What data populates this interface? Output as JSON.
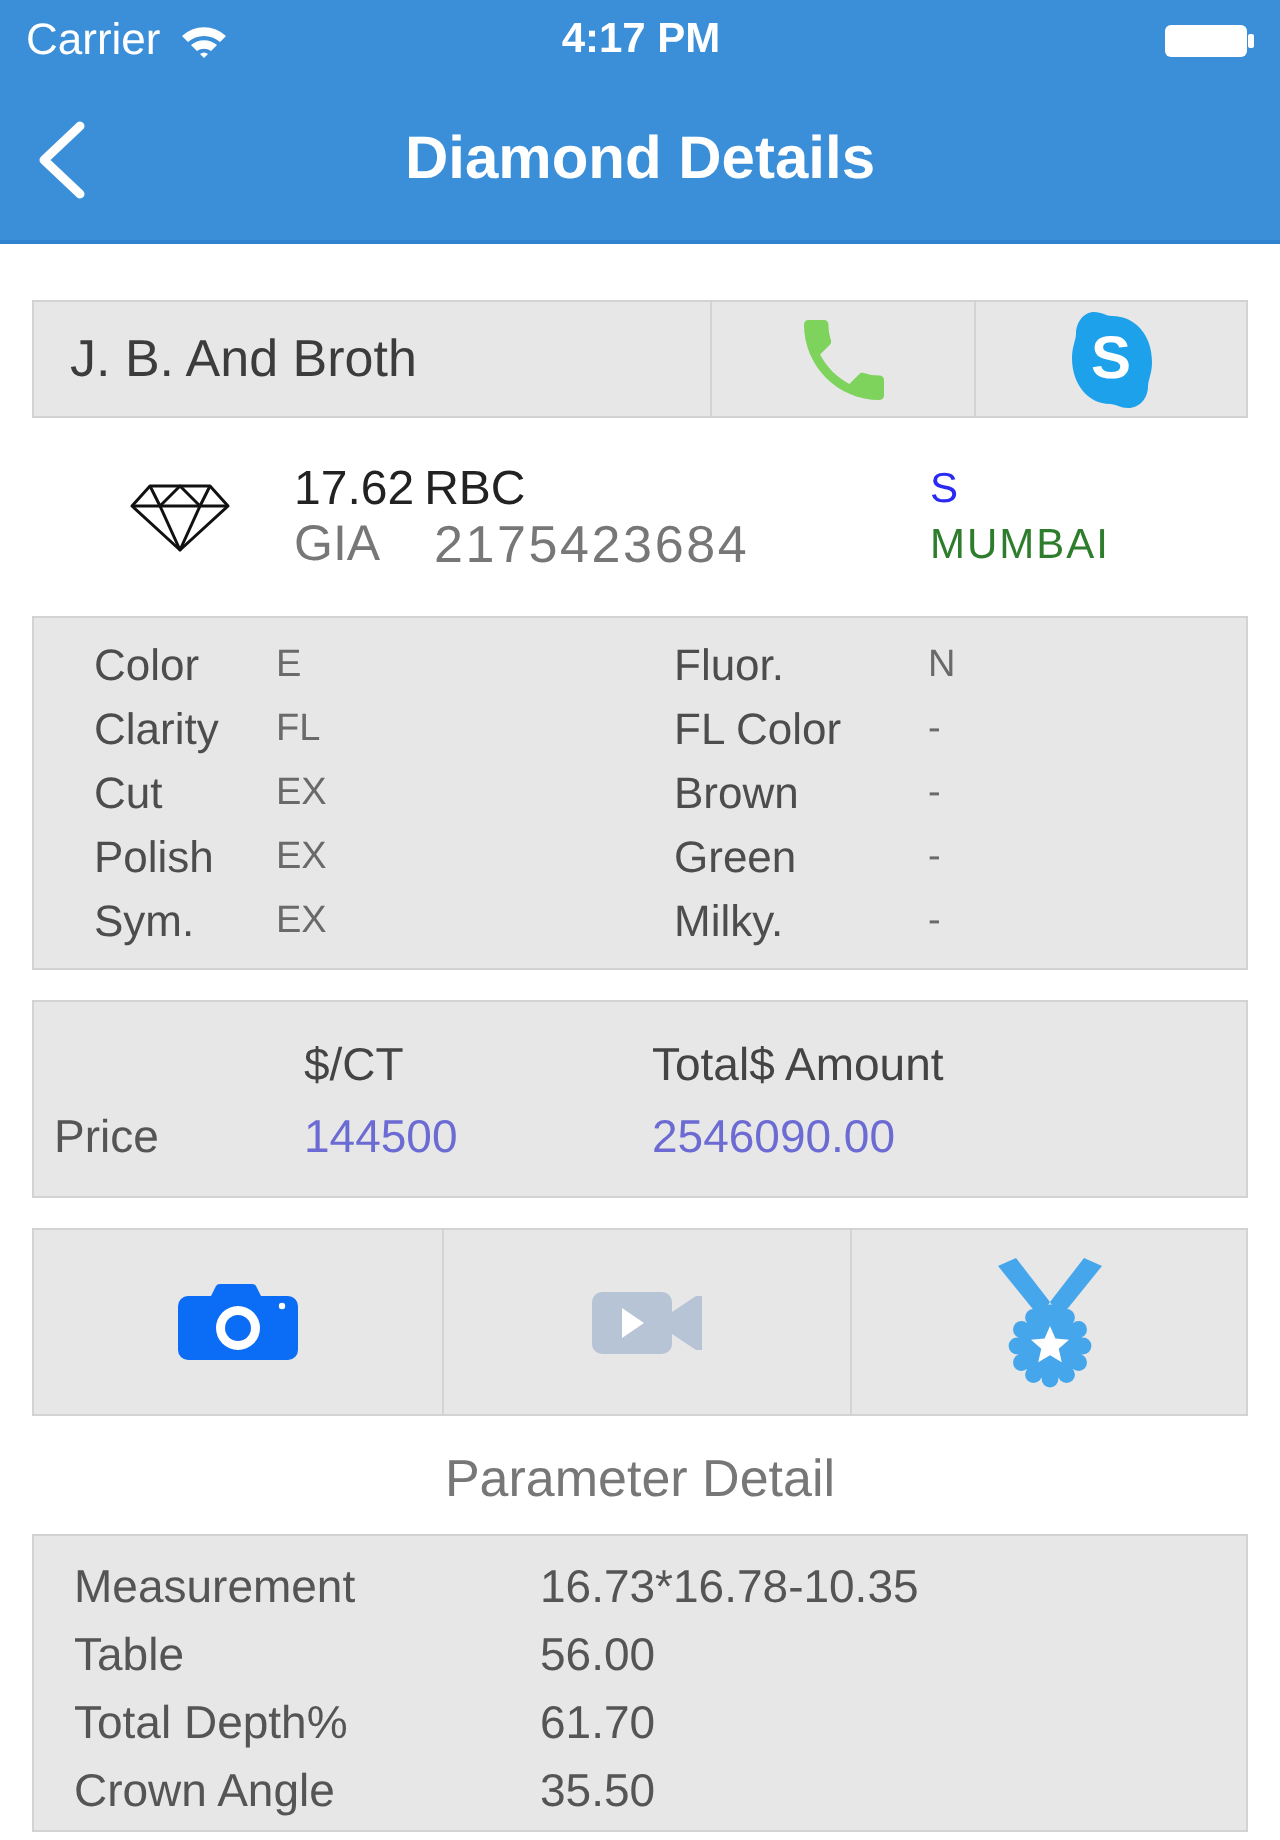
{
  "status_bar": {
    "carrier": "Carrier",
    "time": "4:17 PM"
  },
  "nav_bar": {
    "title": "Diamond Details"
  },
  "seller": {
    "name": "J. B. And Broth",
    "skype_logo_text": "S"
  },
  "stone": {
    "weight": "17.62",
    "shape": "RBC",
    "lab": "GIA",
    "report_number": "2175423684",
    "status": "S",
    "location": "MUMBAI"
  },
  "attributes": {
    "column_1": [
      {
        "label": "Color",
        "value": "E"
      },
      {
        "label": "Clarity",
        "value": "FL"
      },
      {
        "label": "Cut",
        "value": "EX"
      },
      {
        "label": "Polish",
        "value": "EX"
      },
      {
        "label": "Sym.",
        "value": "EX"
      }
    ],
    "column_2": [
      {
        "label": "Fluor.",
        "value": "N"
      },
      {
        "label": "FL Color",
        "value": "-"
      },
      {
        "label": "Brown",
        "value": "-"
      },
      {
        "label": "Green",
        "value": "-"
      },
      {
        "label": "Milky.",
        "value": "-"
      }
    ]
  },
  "price": {
    "row_label": "Price",
    "columns": [
      {
        "heading": "$/CT",
        "value": "144500"
      },
      {
        "heading": "Total$ Amount",
        "value": "2546090.00"
      }
    ]
  },
  "media_buttons": [
    {
      "kind": "camera",
      "disabled": false
    },
    {
      "kind": "video",
      "disabled": true
    },
    {
      "kind": "certificate",
      "disabled": false
    }
  ],
  "parameter_detail": {
    "title": "Parameter Detail",
    "rows": [
      {
        "label": "Measurement",
        "value": "16.73*16.78-10.35"
      },
      {
        "label": "Table",
        "value": "56.00"
      },
      {
        "label": "Total Depth%",
        "value": "61.70"
      },
      {
        "label": "Crown Angle",
        "value": "35.50"
      }
    ]
  }
}
